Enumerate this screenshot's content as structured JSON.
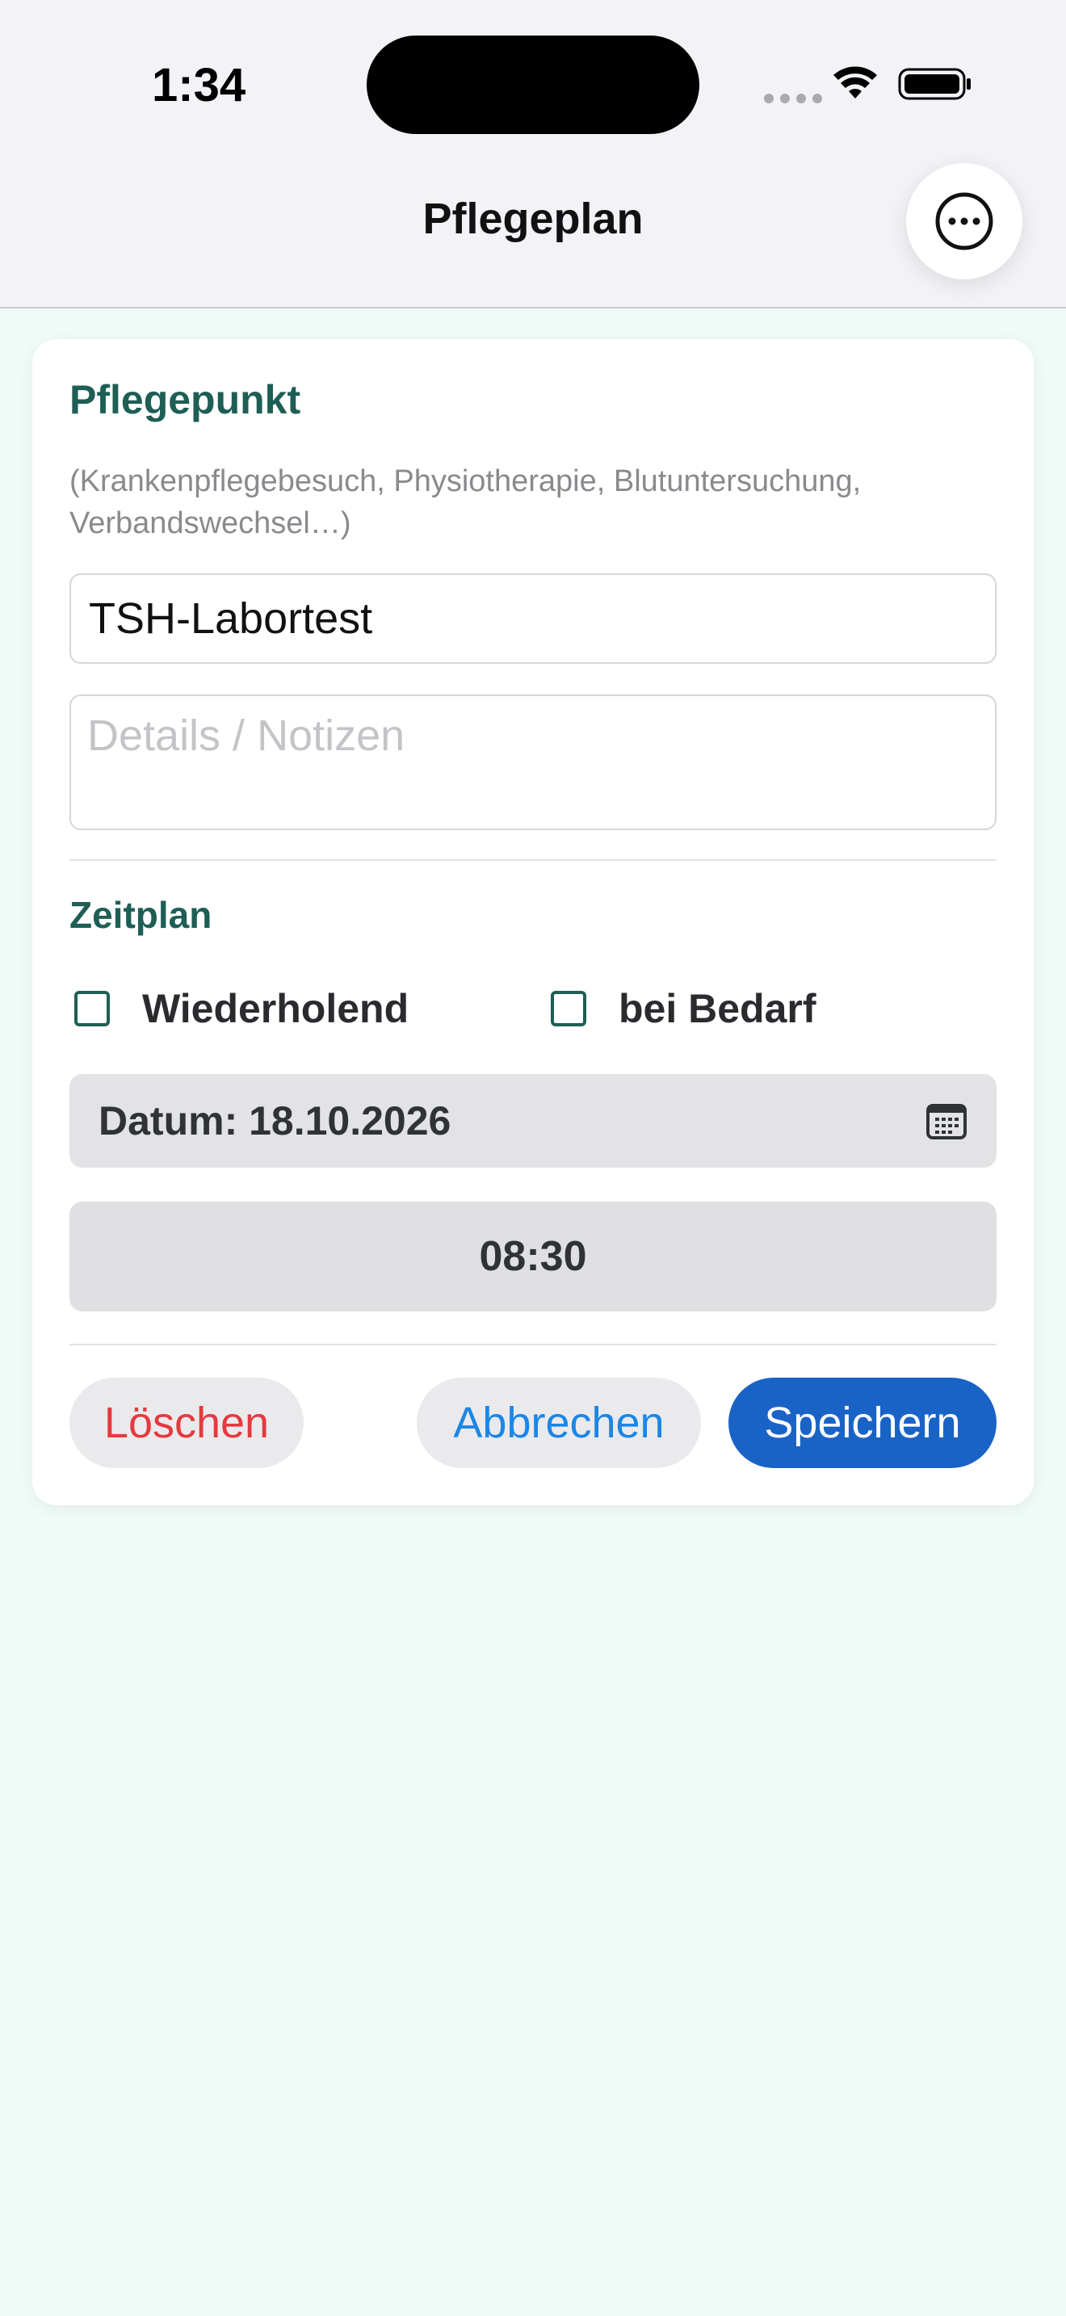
{
  "status_bar": {
    "time": "1:34"
  },
  "nav": {
    "title": "Pflegeplan",
    "more_icon": "ellipsis-circle-icon"
  },
  "form": {
    "care_item_heading": "Pflegepunkt",
    "care_item_hint": "(Krankenpflegebesuch, Physiotherapie, Blutuntersuchung, Verbandswechsel…)",
    "title_value": "TSH-Labortest",
    "notes_placeholder": "Details / Notizen",
    "notes_value": "",
    "schedule_heading": "Zeitplan",
    "recurring_label": "Wiederholend",
    "recurring_checked": false,
    "as_needed_label": "bei Bedarf",
    "as_needed_checked": false,
    "date_label": "Datum: 18.10.2026",
    "date_icon": "calendar-icon",
    "time_value": "08:30"
  },
  "actions": {
    "delete_label": "Löschen",
    "cancel_label": "Abbrechen",
    "save_label": "Speichern"
  },
  "colors": {
    "accent_green": "#1e5e55",
    "primary_blue": "#1a63c6",
    "link_blue": "#1c86e6",
    "destructive_red": "#e5393f",
    "background": "#f0fbf8"
  }
}
